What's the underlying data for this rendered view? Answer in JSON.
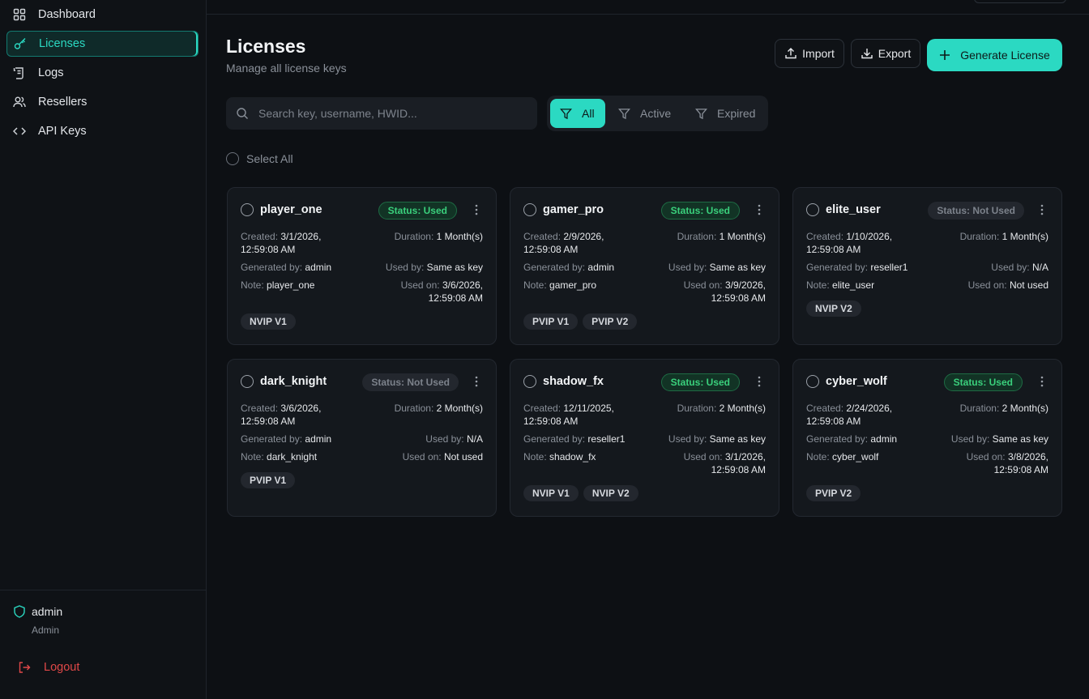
{
  "sidebar": {
    "items": [
      {
        "label": "Dashboard",
        "icon": "grid-icon"
      },
      {
        "label": "Licenses",
        "icon": "key-icon"
      },
      {
        "label": "Logs",
        "icon": "scroll-icon"
      },
      {
        "label": "Resellers",
        "icon": "users-icon"
      },
      {
        "label": "API Keys",
        "icon": "code-icon"
      }
    ],
    "user": {
      "name": "admin",
      "role": "Admin"
    },
    "logout": "Logout"
  },
  "header": {
    "title": "Licenses",
    "subtitle": "Manage all license keys",
    "import_label": "Import",
    "export_label": "Export",
    "generate_label": "Generate License"
  },
  "search": {
    "placeholder": "Search key, username, HWID..."
  },
  "filters": {
    "all": "All",
    "active": "Active",
    "expired": "Expired"
  },
  "select_all": "Select All",
  "colors": {
    "accent": "#2bd9c2",
    "used": "#3ad07c",
    "danger": "#e04848"
  },
  "cards": [
    {
      "name": "player_one",
      "status": "Status: Used",
      "created_label": "Created:",
      "created": "3/1/2026,",
      "created2": "12:59:08 AM",
      "duration_label": "Duration:",
      "duration": "1 Month(s)",
      "gen_label": "Generated by:",
      "gen": "admin",
      "usedby_label": "Used by:",
      "usedby": "Same as key",
      "note_label": "Note:",
      "note": "player_one",
      "usedon_label": "Used on:",
      "usedon": "3/6/2026,",
      "usedon2": "12:59:08 AM",
      "tags": [
        "NVIP V1"
      ]
    },
    {
      "name": "gamer_pro",
      "status": "Status: Used",
      "created_label": "Created:",
      "created": "2/9/2026,",
      "created2": "12:59:08 AM",
      "duration_label": "Duration:",
      "duration": "1 Month(s)",
      "gen_label": "Generated by:",
      "gen": "admin",
      "usedby_label": "Used by:",
      "usedby": "Same as key",
      "note_label": "Note:",
      "note": "gamer_pro",
      "usedon_label": "Used on:",
      "usedon": "3/9/2026,",
      "usedon2": "12:59:08 AM",
      "tags": [
        "PVIP V1",
        "PVIP V2"
      ]
    },
    {
      "name": "elite_user",
      "status": "Status: Not Used",
      "created_label": "Created:",
      "created": "1/10/2026,",
      "created2": "12:59:08 AM",
      "duration_label": "Duration:",
      "duration": "1 Month(s)",
      "gen_label": "Generated by:",
      "gen": "reseller1",
      "usedby_label": "Used by:",
      "usedby": "N/A",
      "note_label": "Note:",
      "note": "elite_user",
      "usedon_label": "Used on:",
      "usedon": "Not used",
      "usedon2": "",
      "tags": [
        "NVIP V2"
      ]
    },
    {
      "name": "dark_knight",
      "status": "Status: Not Used",
      "created_label": "Created:",
      "created": "3/6/2026,",
      "created2": "12:59:08 AM",
      "duration_label": "Duration:",
      "duration": "2 Month(s)",
      "gen_label": "Generated by:",
      "gen": "admin",
      "usedby_label": "Used by:",
      "usedby": "N/A",
      "note_label": "Note:",
      "note": "dark_knight",
      "usedon_label": "Used on:",
      "usedon": "Not used",
      "usedon2": "",
      "tags": [
        "PVIP V1"
      ]
    },
    {
      "name": "shadow_fx",
      "status": "Status: Used",
      "created_label": "Created:",
      "created": "12/11/2025,",
      "created2": "12:59:08 AM",
      "duration_label": "Duration:",
      "duration": "2 Month(s)",
      "gen_label": "Generated by:",
      "gen": "reseller1",
      "usedby_label": "Used by:",
      "usedby": "Same as key",
      "note_label": "Note:",
      "note": "shadow_fx",
      "usedon_label": "Used on:",
      "usedon": "3/1/2026,",
      "usedon2": "12:59:08 AM",
      "tags": [
        "NVIP V1",
        "NVIP V2"
      ]
    },
    {
      "name": "cyber_wolf",
      "status": "Status: Used",
      "created_label": "Created:",
      "created": "2/24/2026,",
      "created2": "12:59:08 AM",
      "duration_label": "Duration:",
      "duration": "2 Month(s)",
      "gen_label": "Generated by:",
      "gen": "admin",
      "usedby_label": "Used by:",
      "usedby": "Same as key",
      "note_label": "Note:",
      "note": "cyber_wolf",
      "usedon_label": "Used on:",
      "usedon": "3/8/2026,",
      "usedon2": "12:59:08 AM",
      "tags": [
        "PVIP V2"
      ]
    }
  ]
}
